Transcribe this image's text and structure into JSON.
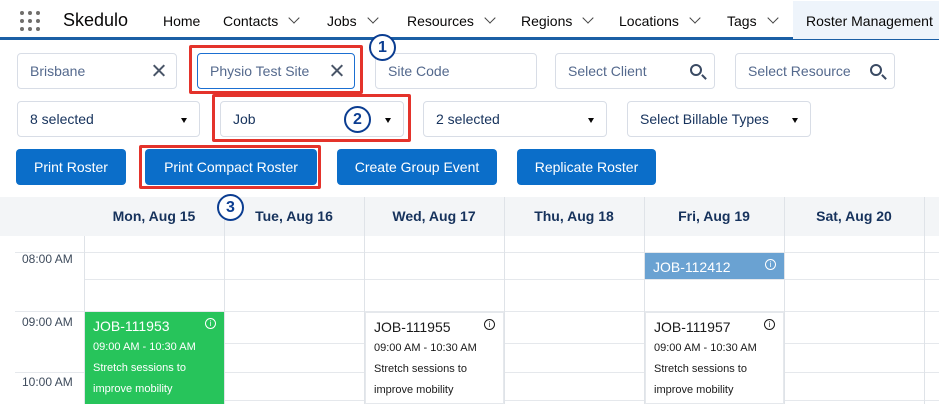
{
  "nav": {
    "brand": "Skedulo",
    "items": [
      {
        "label": "Home",
        "has_dropdown": false
      },
      {
        "label": "Contacts",
        "has_dropdown": true
      },
      {
        "label": "Jobs",
        "has_dropdown": true
      },
      {
        "label": "Resources",
        "has_dropdown": true
      },
      {
        "label": "Regions",
        "has_dropdown": true
      },
      {
        "label": "Locations",
        "has_dropdown": true
      },
      {
        "label": "Tags",
        "has_dropdown": true
      }
    ],
    "active_tab": "Roster Management"
  },
  "filters": {
    "region": {
      "value": "Brisbane"
    },
    "site": {
      "value": "Physio Test Site"
    },
    "site_code": {
      "placeholder": "Site Code"
    },
    "client": {
      "placeholder": "Select Client"
    },
    "resource": {
      "placeholder": "Select Resource"
    },
    "select1": {
      "value": "8 selected"
    },
    "select2": {
      "value": "Job"
    },
    "select3": {
      "value": "2 selected"
    },
    "select4": {
      "value": "Select Billable Types"
    }
  },
  "buttons": {
    "print_roster": "Print Roster",
    "print_compact": "Print Compact Roster",
    "create_group_event": "Create Group Event",
    "replicate_roster": "Replicate Roster"
  },
  "annotations": [
    "1",
    "2",
    "3"
  ],
  "calendar": {
    "days": [
      "Mon, Aug 15",
      "Tue, Aug 16",
      "Wed, Aug 17",
      "Thu, Aug 18",
      "Fri, Aug 19",
      "Sat, Aug 20"
    ],
    "times": [
      "08:00 AM",
      "09:00 AM",
      "10:00 AM"
    ],
    "events": [
      {
        "id": "JOB-111953",
        "time": "09:00 AM - 10:30 AM",
        "desc_line1": "Stretch sessions to",
        "desc_line2": "improve mobility",
        "day": "Mon, Aug 15",
        "color": "#27c45b"
      },
      {
        "id": "JOB-112412",
        "day": "Fri, Aug 19",
        "color": "#6aa2d2"
      },
      {
        "id": "JOB-111955",
        "time": "09:00 AM - 10:30 AM",
        "desc_line1": "Stretch sessions to",
        "desc_line2": "improve mobility",
        "day": "Wed, Aug 17",
        "color": "#ffffff"
      },
      {
        "id": "JOB-111957",
        "time": "09:00 AM - 10:30 AM",
        "desc_line1": "Stretch sessions to",
        "desc_line2": "improve mobility",
        "day": "Fri, Aug 19",
        "color": "#ffffff"
      }
    ]
  },
  "colors": {
    "primary": "#0b6ec9",
    "highlight": "#e4332b",
    "annotation": "#0b3d91",
    "nav_underline": "#1b5fa5"
  }
}
